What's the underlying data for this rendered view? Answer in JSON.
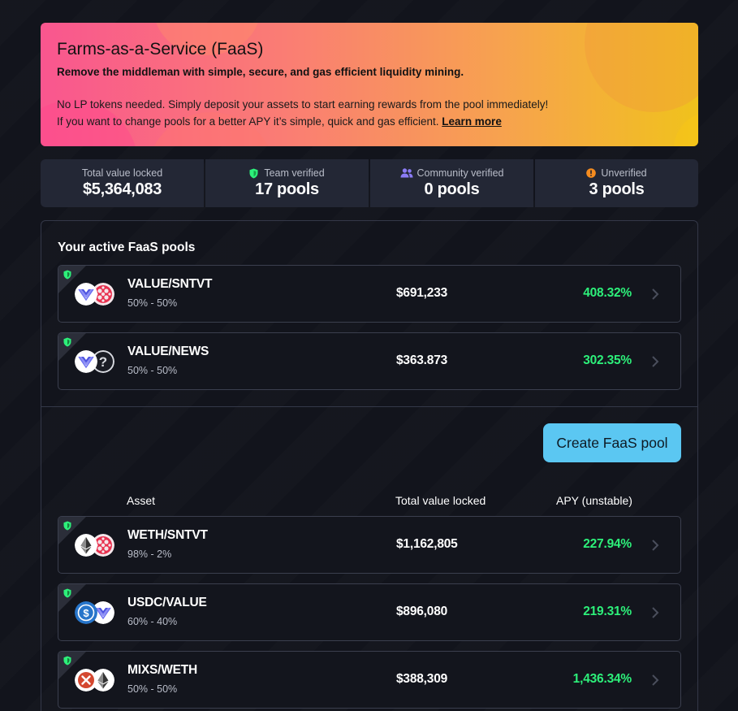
{
  "banner": {
    "title": "Farms-as-a-Service (FaaS)",
    "subtitle": "Remove the middleman with simple, secure, and gas efficient liquidity mining.",
    "line1": "No LP tokens needed. Simply deposit your assets to start earning rewards from the pool immediately!",
    "line2": "If you want to change pools for a better APY it’s simple, quick and gas efficient.",
    "learn_more": "Learn more"
  },
  "stats": [
    {
      "label": "Total value locked",
      "value": "$5,364,083",
      "icon": "none"
    },
    {
      "label": "Team verified",
      "value": "17 pools",
      "icon": "shield-icon"
    },
    {
      "label": "Community verified",
      "value": "0 pools",
      "icon": "users-icon"
    },
    {
      "label": "Unverified",
      "value": "3 pools",
      "icon": "warning-icon"
    }
  ],
  "active_section": {
    "title": "Your active FaaS pools",
    "pools": [
      {
        "name": "VALUE/SNTVT",
        "ratio": "50% - 50%",
        "tvl": "$691,233",
        "apy": "408.32%",
        "tokens": [
          "value-token-icon",
          "sntvt-token-icon"
        ]
      },
      {
        "name": "VALUE/NEWS",
        "ratio": "50% - 50%",
        "tvl": "$363.873",
        "apy": "302.35%",
        "tokens": [
          "value-token-icon",
          "unknown-token-icon"
        ]
      }
    ]
  },
  "create_button": "Create FaaS pool",
  "table": {
    "headers": {
      "asset": "Asset",
      "tvl": "Total value locked",
      "apy": "APY (unstable)"
    },
    "pools": [
      {
        "name": "WETH/SNTVT",
        "ratio": "98% - 2%",
        "tvl": "$1,162,805",
        "apy": "227.94%",
        "tokens": [
          "eth-token-icon",
          "sntvt-token-icon"
        ]
      },
      {
        "name": "USDC/VALUE",
        "ratio": "60% - 40%",
        "tvl": "$896,080",
        "apy": "219.31%",
        "tokens": [
          "usdc-token-icon",
          "value-token-icon"
        ]
      },
      {
        "name": "MIXS/WETH",
        "ratio": "50% - 50%",
        "tvl": "$388,309",
        "apy": "1,436.34%",
        "tokens": [
          "mixs-token-icon",
          "eth-token-icon"
        ]
      }
    ]
  },
  "colors": {
    "apy_green": "#2df07a",
    "verified_green": "#2df07a",
    "button": "#5bc7f2",
    "card_bg": "#232735"
  }
}
